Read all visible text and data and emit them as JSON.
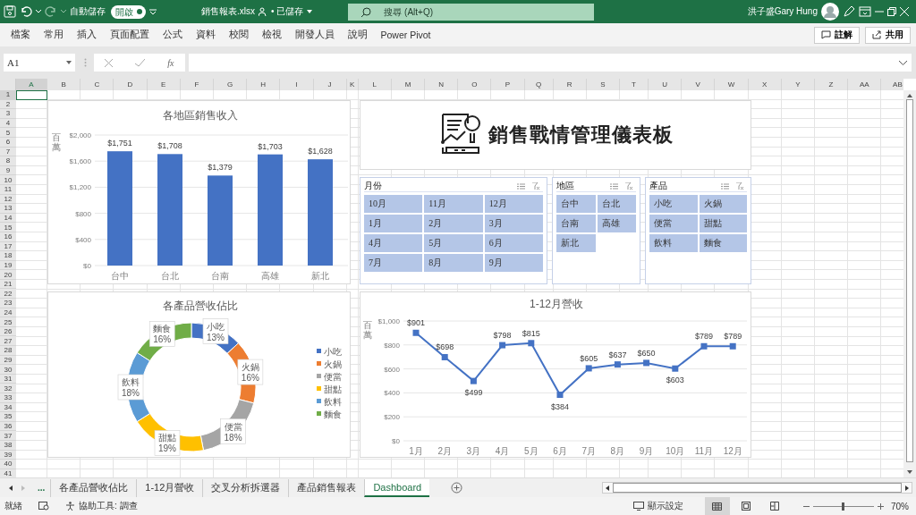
{
  "title_bar": {
    "autosave_label": "自動儲存",
    "autosave_toggle": {
      "label": "開啟",
      "on": true
    },
    "file_name": "銷售報表.xlsx",
    "save_status": "• 已儲存",
    "search": {
      "placeholder": "搜尋 (Alt+Q)"
    },
    "user_name": "洪子盛Gary Hung"
  },
  "ribbon_tabs": [
    {
      "label": "檔案",
      "selected": false
    },
    {
      "label": "常用",
      "selected": false
    },
    {
      "label": "插入",
      "selected": false
    },
    {
      "label": "頁面配置",
      "selected": false
    },
    {
      "label": "公式",
      "selected": false
    },
    {
      "label": "資料",
      "selected": false
    },
    {
      "label": "校閱",
      "selected": false
    },
    {
      "label": "檢視",
      "selected": false
    },
    {
      "label": "開發人員",
      "selected": false
    },
    {
      "label": "說明",
      "selected": false
    },
    {
      "label": "Power Pivot",
      "selected": false
    }
  ],
  "ribbon_buttons": [
    {
      "kind": "comment",
      "label": "註解"
    },
    {
      "kind": "share",
      "label": "共用"
    }
  ],
  "name_box": {
    "value": "A1"
  },
  "formula_bar": {
    "fx_label": "fx"
  },
  "columns": [
    "A",
    "B",
    "C",
    "D",
    "E",
    "F",
    "G",
    "H",
    "I",
    "J",
    "K",
    "L",
    "M",
    "N",
    "O",
    "P",
    "Q",
    "R",
    "S",
    "T",
    "U",
    "V",
    "W",
    "X",
    "Y",
    "Z",
    "AA",
    "AB"
  ],
  "rows": [
    "1",
    "2",
    "3",
    "4",
    "5",
    "6",
    "7",
    "8",
    "9",
    "10",
    "11",
    "12",
    "13",
    "14",
    "15",
    "16",
    "17",
    "18",
    "19",
    "20",
    "21",
    "22",
    "23",
    "24",
    "25",
    "26",
    "27",
    "28",
    "29",
    "30",
    "31",
    "32",
    "33",
    "34",
    "35",
    "36",
    "37",
    "38",
    "39",
    "40",
    "41"
  ],
  "dashboard": {
    "bar_chart": {
      "chart_data": {
        "type": "bar",
        "grid": true,
        "title": "各地區銷售收入",
        "ylabel": "百萬",
        "categories": [
          "台中",
          "台北",
          "台南",
          "高雄",
          "新北"
        ],
        "values": [
          1751,
          1708,
          1379,
          1703,
          1628
        ],
        "value_labels": [
          "$1,751",
          "$1,708",
          "$1,379",
          "$1,703",
          "$1,628"
        ],
        "ylim": [
          0,
          2000
        ],
        "yticks": [
          {
            "value": 0,
            "label": "$0"
          },
          {
            "value": 400,
            "label": "$400"
          },
          {
            "value": 800,
            "label": "$800"
          },
          {
            "value": 1200,
            "label": "$1,200"
          },
          {
            "value": 1600,
            "label": "$1,600"
          },
          {
            "value": 2000,
            "label": "$2,000"
          }
        ]
      }
    },
    "banner": {
      "title": "銷售戰情管理儀表板"
    },
    "slicers": [
      {
        "title": "月份",
        "items": [
          {
            "label": "10月",
            "selected": true
          },
          {
            "label": "11月",
            "selected": true
          },
          {
            "label": "12月",
            "selected": true
          },
          {
            "label": "1月",
            "selected": true
          },
          {
            "label": "2月",
            "selected": true
          },
          {
            "label": "3月",
            "selected": true
          },
          {
            "label": "4月",
            "selected": true
          },
          {
            "label": "5月",
            "selected": true
          },
          {
            "label": "6月",
            "selected": true
          },
          {
            "label": "7月",
            "selected": true
          },
          {
            "label": "8月",
            "selected": true
          },
          {
            "label": "9月",
            "selected": true
          }
        ]
      },
      {
        "title": "地區",
        "items": [
          {
            "label": "台中",
            "selected": true
          },
          {
            "label": "台北",
            "selected": true
          },
          {
            "label": "台南",
            "selected": true
          },
          {
            "label": "高雄",
            "selected": true
          },
          {
            "label": "新北",
            "selected": true
          }
        ]
      },
      {
        "title": "產品",
        "items": [
          {
            "label": "小吃",
            "selected": true
          },
          {
            "label": "火鍋",
            "selected": true
          },
          {
            "label": "便當",
            "selected": true
          },
          {
            "label": "甜點",
            "selected": true
          },
          {
            "label": "飲料",
            "selected": true
          },
          {
            "label": "麵食",
            "selected": true
          }
        ]
      }
    ],
    "donut_chart": {
      "chart_data": {
        "type": "donut",
        "title": "各產品營收佔比",
        "categories": [
          "小吃",
          "火鍋",
          "便當",
          "甜點",
          "飲料",
          "麵食"
        ],
        "values": [
          13,
          16,
          18,
          19,
          18,
          16
        ],
        "value_labels": [
          "13%",
          "16%",
          "18%",
          "19%",
          "18%",
          "16%"
        ]
      },
      "legend": [
        {
          "label": "小吃",
          "color": "#4472c4"
        },
        {
          "label": "火鍋",
          "color": "#ed7d31"
        },
        {
          "label": "便當",
          "color": "#a5a5a5"
        },
        {
          "label": "甜點",
          "color": "#ffc000"
        },
        {
          "label": "飲料",
          "color": "#5b9bd5"
        },
        {
          "label": "麵食",
          "color": "#70ad47"
        }
      ]
    },
    "line_chart": {
      "chart_data": {
        "type": "line",
        "grid": true,
        "marker": "square",
        "title": "1-12月營收",
        "ylabel": "百萬",
        "categories": [
          "1月",
          "2月",
          "3月",
          "4月",
          "5月",
          "6月",
          "7月",
          "8月",
          "9月",
          "10月",
          "11月",
          "12月"
        ],
        "values": [
          901,
          698,
          499,
          798,
          815,
          384,
          605,
          637,
          650,
          603,
          789,
          789
        ],
        "value_labels": [
          "$901",
          "$698",
          "$499",
          "$798",
          "$815",
          "$384",
          "$605",
          "$637",
          "$650",
          "$603",
          "$789",
          "$789"
        ],
        "ylim": [
          0,
          1000
        ],
        "yticks": [
          {
            "value": 0,
            "label": "$0"
          },
          {
            "value": 200,
            "label": "$200"
          },
          {
            "value": 400,
            "label": "$400"
          },
          {
            "value": 600,
            "label": "$600"
          },
          {
            "value": 800,
            "label": "$800"
          },
          {
            "value": 1000,
            "label": "$1,000"
          }
        ]
      }
    }
  },
  "sheet_tabs": {
    "more": "...",
    "tabs": [
      {
        "label": "各產品營收佔比",
        "selected": false
      },
      {
        "label": "1-12月營收",
        "selected": false
      },
      {
        "label": "交叉分析拆選器",
        "selected": false
      },
      {
        "label": "產品銷售報表",
        "selected": false
      },
      {
        "label": "Dashboard",
        "selected": true
      }
    ]
  },
  "status_bar": {
    "ready": "就緒",
    "accessibility": "協助工具: 調查",
    "display_settings": "顯示設定",
    "zoom_slider": {
      "level": 0.5
    },
    "zoom": "70%"
  }
}
